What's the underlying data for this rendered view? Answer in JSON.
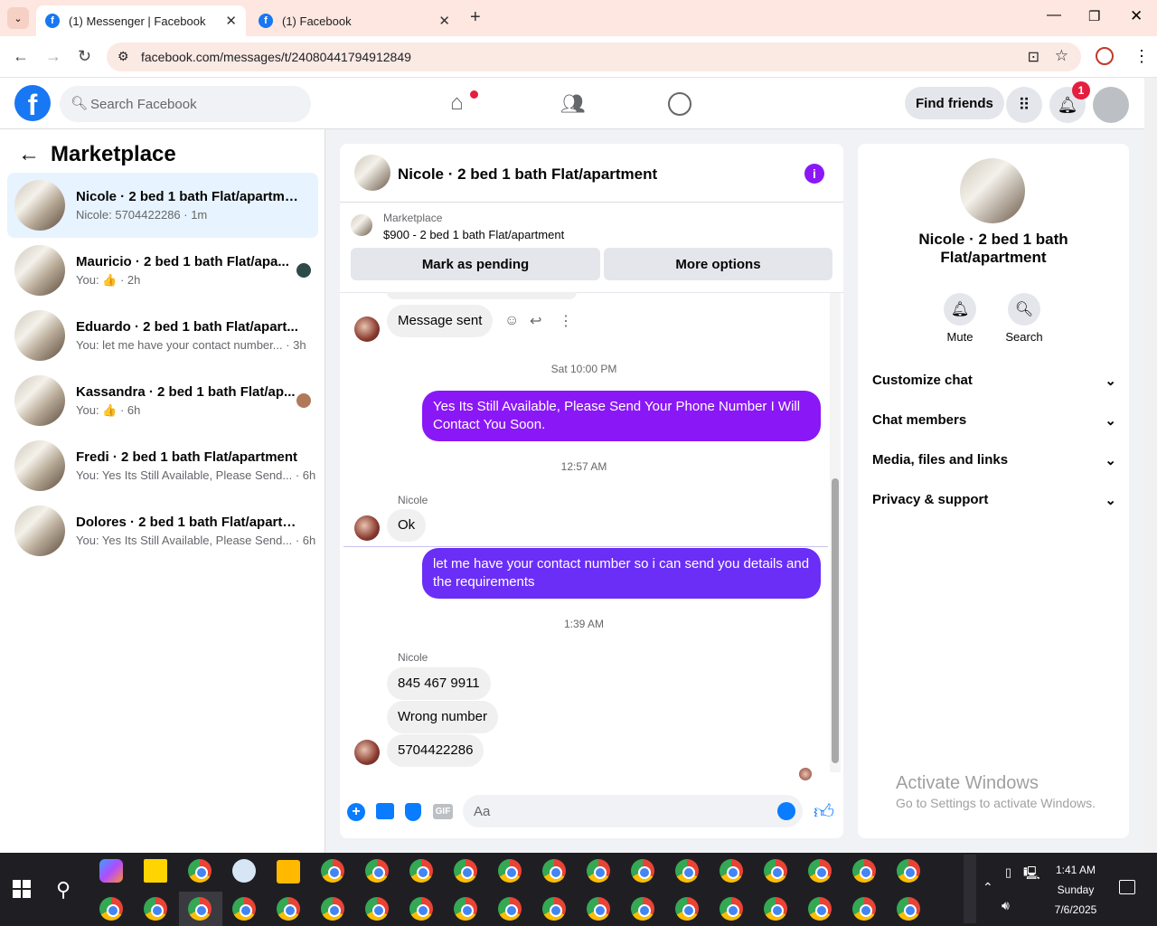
{
  "browser": {
    "tabs": [
      {
        "label": "(1) Messenger | Facebook",
        "active": true
      },
      {
        "label": "(1) Facebook",
        "active": false
      }
    ],
    "url": "facebook.com/messages/t/24080441794912849"
  },
  "header": {
    "logo": "f",
    "search_placeholder": "Search Facebook",
    "find_friends": "Find friends",
    "notification_count": "1"
  },
  "sidebar": {
    "title": "Marketplace",
    "conversations": [
      {
        "name": "Nicole · 2 bed 1 bath Flat/apartment",
        "preview": "Nicole: 5704422286 · 1m"
      },
      {
        "name": "Mauricio · 2 bed 1 bath Flat/apa...",
        "preview": "You: 👍 · 2h"
      },
      {
        "name": "Eduardo · 2 bed 1 bath Flat/apart...",
        "preview": "You: let me have your contact number... · 3h"
      },
      {
        "name": "Kassandra · 2 bed 1 bath Flat/ap...",
        "preview": "You: 👍 · 6h"
      },
      {
        "name": "Fredi · 2 bed 1 bath Flat/apartment",
        "preview": "You: Yes Its Still Available, Please Send... · 6h"
      },
      {
        "name": "Dolores · 2 bed 1 bath Flat/apartm...",
        "preview": "You: Yes Its Still Available, Please Send... · 6h"
      }
    ]
  },
  "chat": {
    "title": "Nicole · 2 bed 1 bath Flat/apartment",
    "listing_source": "Marketplace",
    "listing_title": "$900 - 2 bed 1 bath Flat/apartment",
    "mark_pending": "Mark as pending",
    "more_options": "More options",
    "messages": {
      "m1": "Message sent",
      "ts1": "Sat 10:00 PM",
      "m2": "Yes Its Still Available, Please Send Your Phone Number I Will Contact You Soon.",
      "ts2": "12:57 AM",
      "sender1": "Nicole",
      "m3": "Ok",
      "m4": "let me have your contact number so i can send you details and the requirements",
      "ts3": "1:39 AM",
      "sender2": "Nicole",
      "m5": "845 467 9911",
      "m6": "Wrong number",
      "m7": "5704422286"
    },
    "composer_placeholder": "Aa",
    "gif_label": "GIF"
  },
  "details": {
    "name": "Nicole · 2 bed 1 bath Flat/apartment",
    "mute": "Mute",
    "search": "Search",
    "sections": [
      "Customize chat",
      "Chat members",
      "Media, files and links",
      "Privacy & support"
    ],
    "watermark_title": "Activate Windows",
    "watermark_sub": "Go to Settings to activate Windows."
  },
  "taskbar": {
    "time": "1:41 AM",
    "day": "Sunday",
    "date": "7/6/2025"
  },
  "colors": {
    "fb_blue": "#1877f2",
    "messenger_purple": "#8a18f6",
    "selected_bg": "#e7f3ff"
  }
}
